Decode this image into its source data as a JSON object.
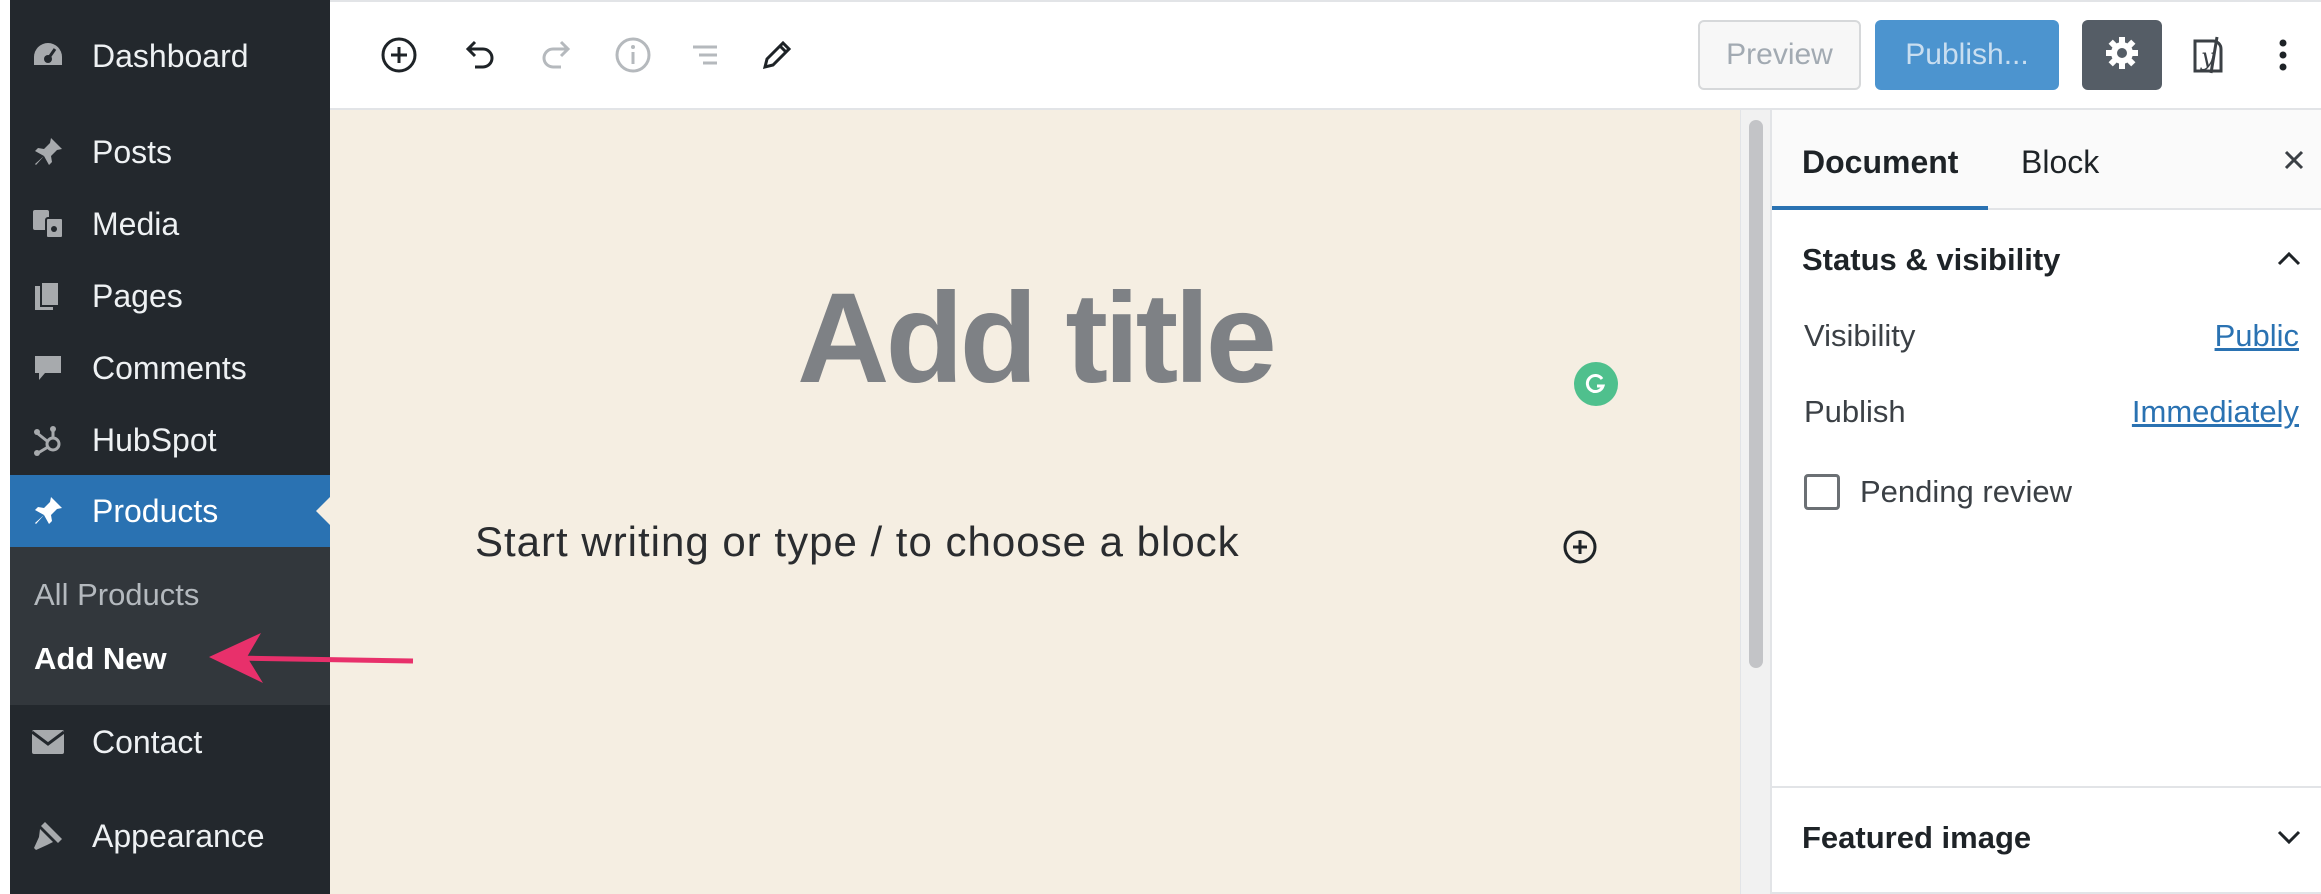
{
  "admin_menu": {
    "items": [
      {
        "label": "Dashboard",
        "icon": "dashboard-icon"
      },
      {
        "label": "Posts",
        "icon": "pushpin-icon"
      },
      {
        "label": "Media",
        "icon": "media-icon"
      },
      {
        "label": "Pages",
        "icon": "pages-icon"
      },
      {
        "label": "Comments",
        "icon": "comment-icon"
      },
      {
        "label": "HubSpot",
        "icon": "hubspot-icon"
      },
      {
        "label": "Products",
        "icon": "pushpin-icon"
      },
      {
        "label": "Contact",
        "icon": "mail-icon"
      },
      {
        "label": "Appearance",
        "icon": "brush-icon"
      }
    ],
    "submenu": {
      "all_products": "All Products",
      "add_new": "Add New"
    }
  },
  "toolbar": {
    "icons": [
      "add-block-icon",
      "undo-icon",
      "redo-icon",
      "info-icon",
      "outline-icon",
      "edit-icon"
    ],
    "preview_label": "Preview",
    "publish_label": "Publish...",
    "settings_icon": "gear-icon",
    "yoast_icon": "yoast-icon",
    "more_icon": "more-vertical-icon"
  },
  "editor": {
    "title_placeholder": "Add title",
    "body_placeholder": "Start writing or type / to choose a block",
    "grammarly_icon": "grammarly-icon",
    "inserter_icon": "add-block-icon"
  },
  "settings_sidebar": {
    "tabs": [
      "Document",
      "Block"
    ],
    "close_icon": "close-icon",
    "status_section": {
      "title": "Status & visibility",
      "visibility_label": "Visibility",
      "visibility_value": "Public",
      "publish_label": "Publish",
      "publish_value": "Immediately",
      "pending_review_label": "Pending review"
    },
    "featured_image_title": "Featured image"
  },
  "colors": {
    "admin_bg": "#23282d",
    "active_menu": "#2a72b2",
    "canvas_bg": "#f5eee2",
    "publish_button": "#4c94cf",
    "annotation_arrow": "#e8306b"
  }
}
